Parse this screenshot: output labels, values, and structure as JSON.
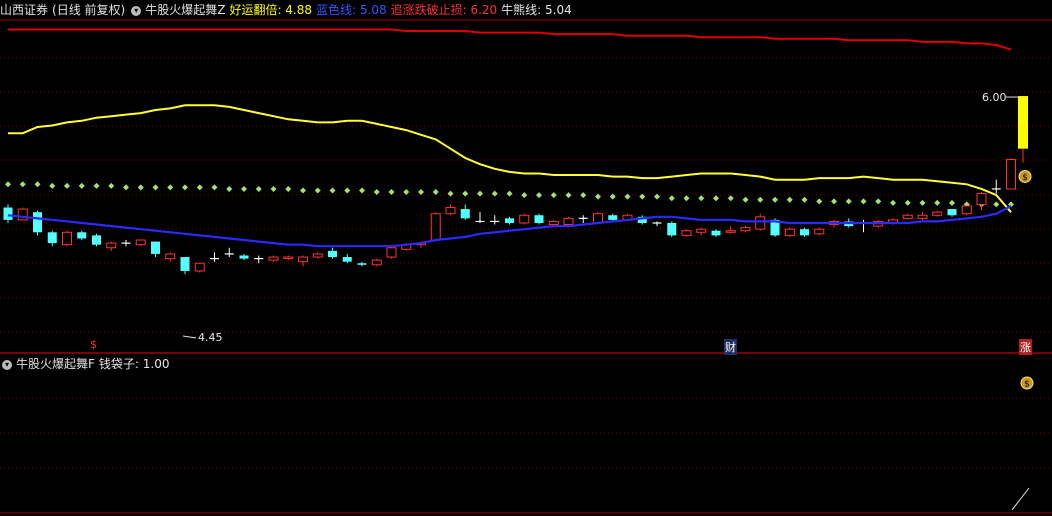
{
  "header_main": {
    "stock": "山西证券",
    "period": "(日线 前复权)",
    "indicator": "牛股火爆起舞Z",
    "items": [
      {
        "label": "好运翻倍: 4.88",
        "color": "#ffff00"
      },
      {
        "label": "蓝色线: 5.08",
        "color": "#3355ff"
      },
      {
        "label": "追涨跌破止损: 6.20",
        "color": "#ff3333"
      },
      {
        "label": "牛熊线: 5.04",
        "color": "#e6e6e6"
      }
    ]
  },
  "header_sub": {
    "indicator": "牛股火爆起舞F",
    "items": [
      {
        "label": "钱袋子: 1.00",
        "color": "#e6e6e6"
      }
    ]
  },
  "annotations": {
    "max_label": "6.00",
    "min_label": "4.45",
    "marker_left": "$",
    "marker_cai": "财",
    "marker_zhang": "涨"
  },
  "colors": {
    "up": "#ff3333",
    "down": "#54ffff",
    "blue_line": "#2a2aff",
    "yellow_line": "#ffff33",
    "red_line": "#e00000",
    "dots": "#a8e070"
  },
  "chart_data": {
    "type": "candlestick",
    "y_range": [
      4.45,
      6.0
    ],
    "candles": [
      {
        "o": 5.28,
        "c": 5.2,
        "h": 5.3,
        "l": 5.18
      },
      {
        "o": 5.2,
        "c": 5.27,
        "h": 5.28,
        "l": 5.2
      },
      {
        "o": 5.25,
        "c": 5.12,
        "h": 5.26,
        "l": 5.1
      },
      {
        "o": 5.12,
        "c": 5.05,
        "h": 5.13,
        "l": 5.03
      },
      {
        "o": 5.04,
        "c": 5.12,
        "h": 5.13,
        "l": 5.03
      },
      {
        "o": 5.12,
        "c": 5.08,
        "h": 5.13,
        "l": 5.07
      },
      {
        "o": 5.1,
        "c": 5.04,
        "h": 5.11,
        "l": 5.03
      },
      {
        "o": 5.02,
        "c": 5.05,
        "h": 5.06,
        "l": 5.0
      },
      {
        "o": 5.05,
        "c": 5.05,
        "h": 5.07,
        "l": 5.03
      },
      {
        "o": 5.04,
        "c": 5.07,
        "h": 5.07,
        "l": 5.03
      },
      {
        "o": 5.06,
        "c": 4.98,
        "h": 5.06,
        "l": 4.96
      },
      {
        "o": 4.95,
        "c": 4.98,
        "h": 4.99,
        "l": 4.93
      },
      {
        "o": 4.96,
        "c": 4.87,
        "h": 4.96,
        "l": 4.85
      },
      {
        "o": 4.87,
        "c": 4.92,
        "h": 4.92,
        "l": 4.86
      },
      {
        "o": 4.95,
        "c": 4.95,
        "h": 4.99,
        "l": 4.93
      },
      {
        "o": 4.98,
        "c": 4.98,
        "h": 5.02,
        "l": 4.96
      },
      {
        "o": 4.97,
        "c": 4.95,
        "h": 4.98,
        "l": 4.94
      },
      {
        "o": 4.95,
        "c": 4.95,
        "h": 4.97,
        "l": 4.92
      },
      {
        "o": 4.94,
        "c": 4.96,
        "h": 4.97,
        "l": 4.93
      },
      {
        "o": 4.95,
        "c": 4.96,
        "h": 4.97,
        "l": 4.94
      },
      {
        "o": 4.93,
        "c": 4.96,
        "h": 4.97,
        "l": 4.9
      },
      {
        "o": 4.96,
        "c": 4.98,
        "h": 4.99,
        "l": 4.95
      },
      {
        "o": 5.0,
        "c": 4.96,
        "h": 5.02,
        "l": 4.95
      },
      {
        "o": 4.96,
        "c": 4.93,
        "h": 4.98,
        "l": 4.92
      },
      {
        "o": 4.92,
        "c": 4.91,
        "h": 4.93,
        "l": 4.9
      },
      {
        "o": 4.91,
        "c": 4.94,
        "h": 4.95,
        "l": 4.9
      },
      {
        "o": 4.96,
        "c": 5.02,
        "h": 5.03,
        "l": 4.95
      },
      {
        "o": 5.01,
        "c": 5.04,
        "h": 5.05,
        "l": 5.0
      },
      {
        "o": 5.04,
        "c": 5.05,
        "h": 5.06,
        "l": 5.02
      },
      {
        "o": 5.07,
        "c": 5.24,
        "h": 5.25,
        "l": 5.06
      },
      {
        "o": 5.24,
        "c": 5.28,
        "h": 5.3,
        "l": 5.23
      },
      {
        "o": 5.27,
        "c": 5.21,
        "h": 5.3,
        "l": 5.2
      },
      {
        "o": 5.19,
        "c": 5.19,
        "h": 5.25,
        "l": 5.18
      },
      {
        "o": 5.19,
        "c": 5.19,
        "h": 5.23,
        "l": 5.17
      },
      {
        "o": 5.21,
        "c": 5.18,
        "h": 5.22,
        "l": 5.17
      },
      {
        "o": 5.18,
        "c": 5.23,
        "h": 5.24,
        "l": 5.17
      },
      {
        "o": 5.23,
        "c": 5.18,
        "h": 5.24,
        "l": 5.17
      },
      {
        "o": 5.17,
        "c": 5.19,
        "h": 5.2,
        "l": 5.16
      },
      {
        "o": 5.17,
        "c": 5.21,
        "h": 5.22,
        "l": 5.17
      },
      {
        "o": 5.21,
        "c": 5.21,
        "h": 5.23,
        "l": 5.18
      },
      {
        "o": 5.18,
        "c": 5.24,
        "h": 5.25,
        "l": 5.18
      },
      {
        "o": 5.23,
        "c": 5.2,
        "h": 5.24,
        "l": 5.19
      },
      {
        "o": 5.2,
        "c": 5.23,
        "h": 5.24,
        "l": 5.19
      },
      {
        "o": 5.22,
        "c": 5.18,
        "h": 5.23,
        "l": 5.17
      },
      {
        "o": 5.18,
        "c": 5.18,
        "h": 5.19,
        "l": 5.16
      },
      {
        "o": 5.18,
        "c": 5.1,
        "h": 5.19,
        "l": 5.09
      },
      {
        "o": 5.1,
        "c": 5.13,
        "h": 5.14,
        "l": 5.09
      },
      {
        "o": 5.12,
        "c": 5.14,
        "h": 5.15,
        "l": 5.1
      },
      {
        "o": 5.13,
        "c": 5.1,
        "h": 5.14,
        "l": 5.09
      },
      {
        "o": 5.12,
        "c": 5.13,
        "h": 5.16,
        "l": 5.11
      },
      {
        "o": 5.13,
        "c": 5.15,
        "h": 5.16,
        "l": 5.12
      },
      {
        "o": 5.14,
        "c": 5.22,
        "h": 5.24,
        "l": 5.13
      },
      {
        "o": 5.2,
        "c": 5.1,
        "h": 5.21,
        "l": 5.09
      },
      {
        "o": 5.1,
        "c": 5.14,
        "h": 5.15,
        "l": 5.09
      },
      {
        "o": 5.14,
        "c": 5.1,
        "h": 5.15,
        "l": 5.09
      },
      {
        "o": 5.11,
        "c": 5.14,
        "h": 5.15,
        "l": 5.1
      },
      {
        "o": 5.17,
        "c": 5.19,
        "h": 5.2,
        "l": 5.15
      },
      {
        "o": 5.19,
        "c": 5.16,
        "h": 5.21,
        "l": 5.15
      },
      {
        "o": 5.18,
        "c": 5.18,
        "h": 5.2,
        "l": 5.12
      },
      {
        "o": 5.16,
        "c": 5.19,
        "h": 5.2,
        "l": 5.15
      },
      {
        "o": 5.18,
        "c": 5.2,
        "h": 5.21,
        "l": 5.17
      },
      {
        "o": 5.21,
        "c": 5.23,
        "h": 5.24,
        "l": 5.2
      },
      {
        "o": 5.21,
        "c": 5.23,
        "h": 5.25,
        "l": 5.2
      },
      {
        "o": 5.23,
        "c": 5.25,
        "h": 5.26,
        "l": 5.22
      },
      {
        "o": 5.27,
        "c": 5.23,
        "h": 5.27,
        "l": 5.22
      },
      {
        "o": 5.24,
        "c": 5.29,
        "h": 5.29,
        "l": 5.23
      },
      {
        "o": 5.3,
        "c": 5.37,
        "h": 5.38,
        "l": 5.26
      },
      {
        "o": 5.4,
        "c": 5.4,
        "h": 5.46,
        "l": 5.37
      },
      {
        "o": 5.4,
        "c": 5.59,
        "h": 5.6,
        "l": 5.4
      }
    ],
    "blue_line": [
      5.23,
      5.22,
      5.21,
      5.2,
      5.19,
      5.18,
      5.17,
      5.16,
      5.15,
      5.14,
      5.13,
      5.12,
      5.11,
      5.1,
      5.09,
      5.08,
      5.07,
      5.06,
      5.05,
      5.04,
      5.04,
      5.03,
      5.03,
      5.03,
      5.03,
      5.03,
      5.03,
      5.04,
      5.05,
      5.07,
      5.08,
      5.09,
      5.11,
      5.12,
      5.13,
      5.14,
      5.15,
      5.16,
      5.16,
      5.17,
      5.18,
      5.19,
      5.2,
      5.21,
      5.22,
      5.22,
      5.21,
      5.2,
      5.2,
      5.2,
      5.19,
      5.19,
      5.19,
      5.18,
      5.18,
      5.18,
      5.18,
      5.18,
      5.18,
      5.18,
      5.18,
      5.18,
      5.19,
      5.19,
      5.2,
      5.21,
      5.22,
      5.24,
      5.29
    ],
    "yellow_line": [
      5.76,
      5.76,
      5.8,
      5.81,
      5.83,
      5.84,
      5.86,
      5.87,
      5.88,
      5.89,
      5.91,
      5.92,
      5.94,
      5.94,
      5.94,
      5.93,
      5.91,
      5.89,
      5.87,
      5.85,
      5.84,
      5.83,
      5.83,
      5.84,
      5.84,
      5.82,
      5.8,
      5.78,
      5.75,
      5.72,
      5.66,
      5.6,
      5.56,
      5.53,
      5.51,
      5.5,
      5.5,
      5.49,
      5.49,
      5.49,
      5.49,
      5.48,
      5.48,
      5.47,
      5.47,
      5.48,
      5.49,
      5.5,
      5.5,
      5.5,
      5.49,
      5.48,
      5.46,
      5.46,
      5.46,
      5.47,
      5.47,
      5.47,
      5.48,
      5.47,
      5.46,
      5.46,
      5.46,
      5.45,
      5.44,
      5.43,
      5.4,
      5.36,
      5.25
    ],
    "red_line": [
      6.43,
      6.43,
      6.43,
      6.43,
      6.43,
      6.43,
      6.43,
      6.43,
      6.43,
      6.43,
      6.43,
      6.43,
      6.43,
      6.43,
      6.43,
      6.43,
      6.43,
      6.43,
      6.43,
      6.43,
      6.43,
      6.43,
      6.43,
      6.43,
      6.43,
      6.43,
      6.43,
      6.42,
      6.42,
      6.42,
      6.42,
      6.42,
      6.41,
      6.41,
      6.41,
      6.41,
      6.41,
      6.4,
      6.4,
      6.4,
      6.4,
      6.4,
      6.39,
      6.39,
      6.39,
      6.39,
      6.39,
      6.38,
      6.38,
      6.38,
      6.38,
      6.38,
      6.37,
      6.37,
      6.37,
      6.37,
      6.37,
      6.36,
      6.36,
      6.36,
      6.36,
      6.36,
      6.35,
      6.35,
      6.35,
      6.34,
      6.34,
      6.33,
      6.3
    ],
    "dots_line": [
      5.43,
      5.43,
      5.43,
      5.42,
      5.42,
      5.42,
      5.42,
      5.42,
      5.41,
      5.41,
      5.41,
      5.41,
      5.41,
      5.41,
      5.41,
      5.4,
      5.4,
      5.4,
      5.4,
      5.4,
      5.39,
      5.39,
      5.39,
      5.39,
      5.39,
      5.38,
      5.38,
      5.38,
      5.38,
      5.38,
      5.37,
      5.37,
      5.37,
      5.37,
      5.37,
      5.36,
      5.36,
      5.36,
      5.36,
      5.36,
      5.35,
      5.35,
      5.35,
      5.35,
      5.35,
      5.34,
      5.34,
      5.34,
      5.34,
      5.34,
      5.33,
      5.33,
      5.33,
      5.33,
      5.33,
      5.32,
      5.32,
      5.32,
      5.32,
      5.32,
      5.31,
      5.31,
      5.31,
      5.31,
      5.31,
      5.3,
      5.3,
      5.3,
      5.3
    ],
    "last_bar_extension": {
      "low": 5.66,
      "high": 6.0
    }
  }
}
